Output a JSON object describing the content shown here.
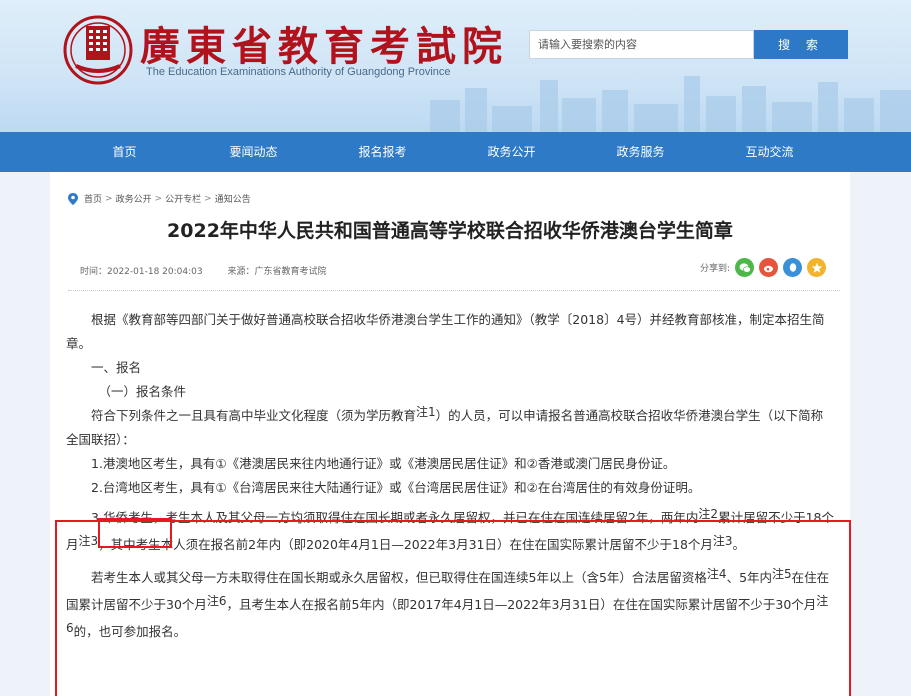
{
  "header": {
    "title": "廣東省教育考試院",
    "subtitle": "The Education Examinations Authority of Guangdong Province",
    "search_placeholder": "请输入要搜索的内容",
    "search_button": "搜 索"
  },
  "nav": {
    "items": [
      "首页",
      "要闻动态",
      "报名报考",
      "政务公开",
      "政务服务",
      "互动交流"
    ]
  },
  "breadcrumb": [
    "首页",
    "政务公开",
    "公开专栏",
    "通知公告"
  ],
  "article": {
    "title": "2022年中华人民共和国普通高等学校联合招收华侨港澳台学生简章",
    "time": "时间：2022-01-18 20:04:03",
    "source": "来源：广东省教育考试院",
    "share_label": "分享到:"
  },
  "body": {
    "p1": "根据《教育部等四部门关于做好普通高校联合招收华侨港澳台学生工作的通知》（教学〔2018〕4号）并经教育部核准，制定本招生简章。",
    "h1": "一、报名",
    "h2": "（一）报名条件",
    "p2_a": "符合下列条件之一且具有高中毕业文化程度（须为学历教育",
    "p2_note": "注1",
    "p2_b": "）的人员，可以申请报名普通高校联合招收华侨港澳台学生（以下简称全国联招）：",
    "item1": "1.港澳地区考生，具有①《港澳居民来往内地通行证》或《港澳居民居住证》和②香港或澳门居民身份证。",
    "item2": "2.台湾地区考生，具有①《台湾居民来往大陆通行证》或《台湾居民居住证》和②在台湾居住的有效身份证明。",
    "item3_num": "3.",
    "item3_label": "华侨考生，",
    "item3_a": "考生本人及其父母一方均须取得住在国长期或者永久居留权，并已在住在国连续居留2年，两年内",
    "item3_note2": "注2",
    "item3_b": "累计居留不少于18个月",
    "item3_note3": "注3",
    "item3_c": "，其中考生本人须在报名前2年内（即2020年4月1日—2022年3月31日）在住在国实际累计居留不少于18个月",
    "item3_note3b": "注3",
    "item3_d": "。",
    "p4_a": "若考生本人或其父母一方未取得住在国长期或永久居留权，但已取得住在国连续5年以上（含5年）合法居留资格",
    "p4_note4": "注4",
    "p4_b": "、5年内",
    "p4_note5": "注5",
    "p4_c": "在住在国累计居留不少于30个月",
    "p4_note6": "注6",
    "p4_d": "，且考生本人在报名前5年内（即2017年4月1日—2022年3月31日）在住在国实际累计居留不少于30个月",
    "p4_note6b": "注6",
    "p4_e": "的，也可参加报名。"
  },
  "colors": {
    "brand_red": "#b0131b",
    "nav_blue": "#2f7ac7",
    "highlight_red": "#e5191f"
  }
}
